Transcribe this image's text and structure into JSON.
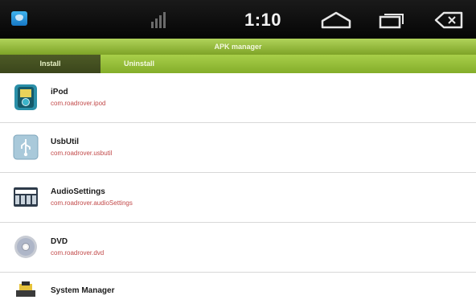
{
  "status_bar": {
    "time": "1:10",
    "icons": [
      "app-notification-icon",
      "signal-icon",
      "home-icon",
      "recent-apps-icon",
      "back-icon"
    ]
  },
  "app": {
    "title": "APK manager",
    "tabs": [
      {
        "label": "Install",
        "active": true
      },
      {
        "label": "Uninstall",
        "active": false
      }
    ]
  },
  "apps": [
    {
      "name": "iPod",
      "package": "com.roadrover.ipod",
      "icon": "ipod-icon"
    },
    {
      "name": "UsbUtil",
      "package": "com.roadrover.usbutil",
      "icon": "usb-icon"
    },
    {
      "name": "AudioSettings",
      "package": "com.roadrover.audioSettings",
      "icon": "audio-settings-icon"
    },
    {
      "name": "DVD",
      "package": "com.roadrover.dvd",
      "icon": "dvd-icon"
    },
    {
      "name": "System Manager",
      "package": "",
      "icon": "system-manager-icon"
    }
  ],
  "colors": {
    "accent_green": "#9cc43f",
    "tab_active": "#45511f",
    "package_text": "#c24a4a"
  }
}
